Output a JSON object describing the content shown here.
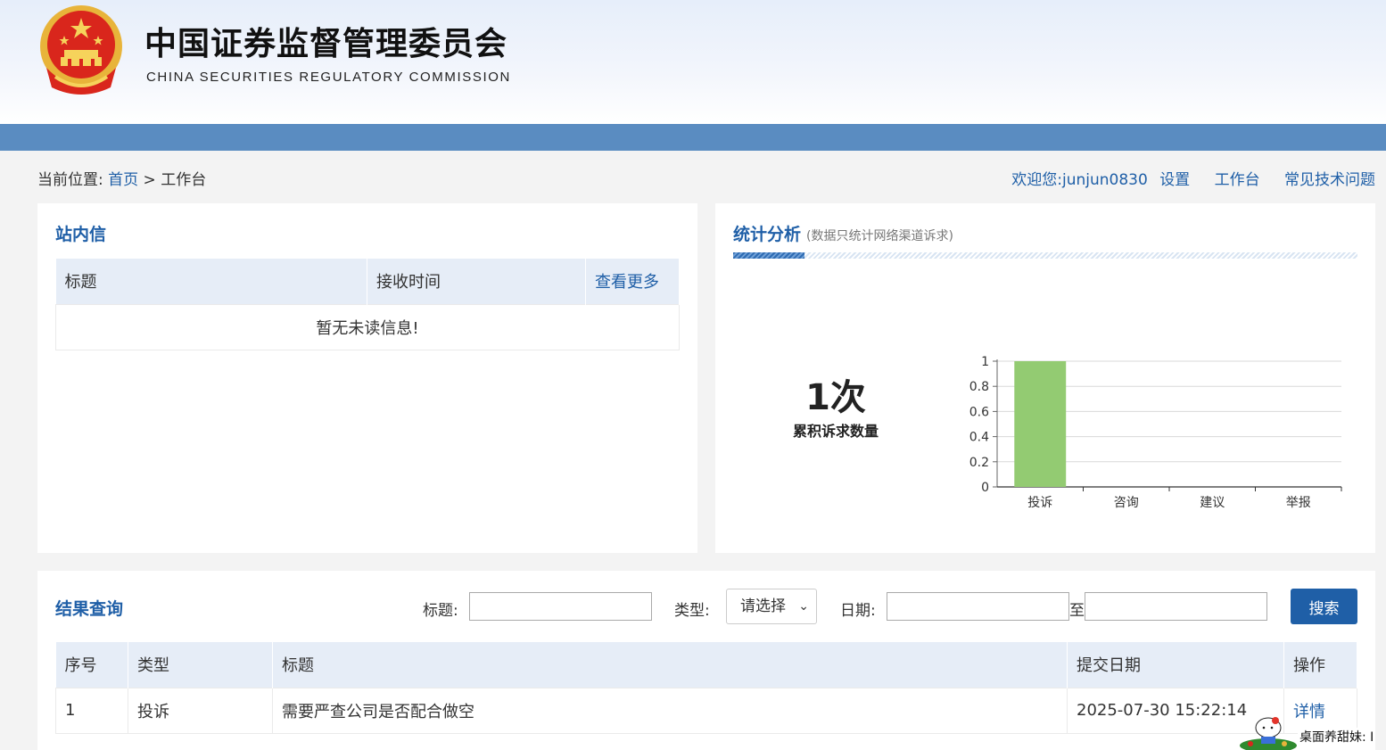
{
  "header": {
    "title_cn": "中国证券监督管理委员会",
    "title_en": "CHINA SECURITIES REGULATORY COMMISSION"
  },
  "breadcrumb": {
    "prefix": "当前位置:",
    "home": "首页",
    "separator": ">",
    "current": "工作台"
  },
  "topnav": {
    "welcome": "欢迎您:",
    "username": "junjun0830",
    "settings": "设置",
    "workbench": "工作台",
    "faq": "常见技术问题"
  },
  "messages": {
    "title": "站内信",
    "col_title": "标题",
    "col_time": "接收时间",
    "more": "查看更多",
    "empty": "暂无未读信息!"
  },
  "stats": {
    "title": "统计分析",
    "subtitle": "(数据只统计网络渠道诉求)",
    "count": "1次",
    "count_label": "累积诉求数量"
  },
  "chart_data": {
    "type": "bar",
    "categories": [
      "投诉",
      "咨询",
      "建议",
      "举报"
    ],
    "values": [
      1,
      0,
      0,
      0
    ],
    "ylim": [
      0,
      1
    ],
    "yticks": [
      "0",
      "0.2",
      "0.4",
      "0.6",
      "0.8",
      "1"
    ],
    "grid": true,
    "bar_color": "#93cb72"
  },
  "query": {
    "title": "结果查询",
    "title_label": "标题:",
    "title_value": "",
    "type_label": "类型:",
    "type_selected": "请选择",
    "date_label": "日期:",
    "date_from": "",
    "date_to_label": "至",
    "date_to": "",
    "search": "搜索"
  },
  "results": {
    "headers": [
      "序号",
      "类型",
      "标题",
      "提交日期",
      "操作"
    ],
    "rows": [
      [
        "1",
        "投诉",
        "需要严查公司是否配合做空",
        "2025-07-30 15:22:14",
        "详情"
      ]
    ]
  },
  "widget": {
    "text": "桌面养甜妹: I"
  },
  "colors": {
    "accent": "#1f5fa7",
    "bluebar": "#5a8cc1",
    "table_header": "#e6edf7"
  }
}
